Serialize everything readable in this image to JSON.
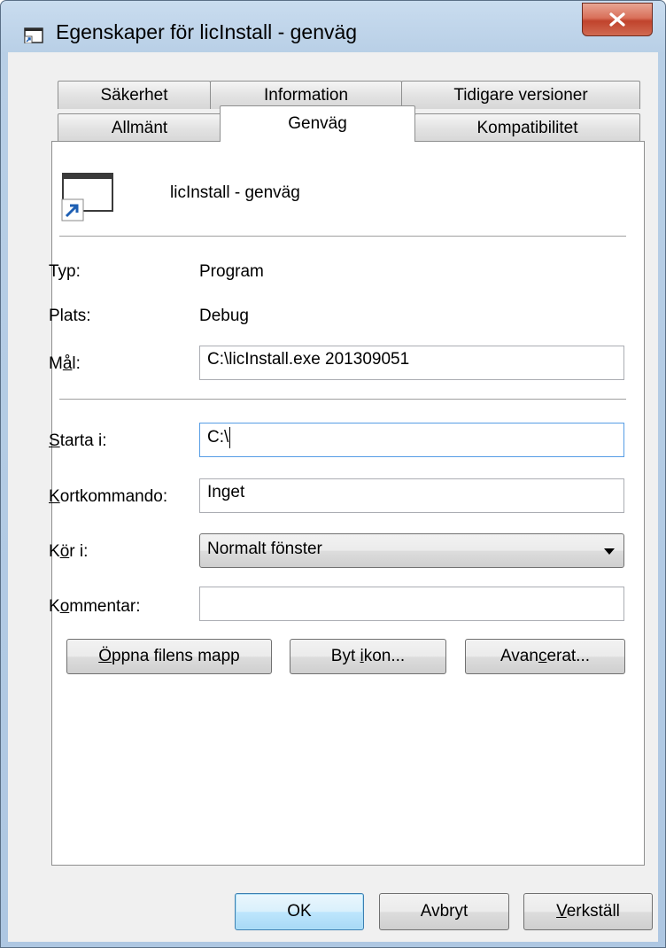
{
  "window": {
    "title": "Egenskaper för licInstall - genväg",
    "close_label": "X"
  },
  "tabs": {
    "row_back": [
      "Säkerhet",
      "Information",
      "Tidigare versioner"
    ],
    "row_front": [
      "Allmänt",
      "Genväg",
      "Kompatibilitet"
    ],
    "active": "Genväg"
  },
  "shortcut": {
    "name": "licInstall - genväg",
    "icon": "shortcut-window-icon"
  },
  "props": {
    "type_label": "Typ:",
    "type_value": "Program",
    "location_label": "Plats:",
    "location_value": "Debug",
    "target_label_pre": "M",
    "target_label_key": "å",
    "target_label_post": "l:",
    "target_value": "C:\\licInstall.exe 201309051",
    "startin_label_key": "S",
    "startin_label_post": "tarta i:",
    "startin_value": "C:\\",
    "hotkey_label_key": "K",
    "hotkey_label_post": "ortkommando:",
    "hotkey_value": "Inget",
    "run_label_pre": "K",
    "run_label_key": "ö",
    "run_label_post": "r i:",
    "run_value": "Normalt fönster",
    "comment_label_pre": "K",
    "comment_label_key": "o",
    "comment_label_post": "mmentar:",
    "comment_value": ""
  },
  "actions": {
    "open_pre": "",
    "open_key": "Ö",
    "open_post": "ppna filens mapp",
    "change_icon_pre": "Byt ",
    "change_icon_key": "i",
    "change_icon_post": "kon...",
    "advanced_pre": "Avan",
    "advanced_key": "c",
    "advanced_post": "erat..."
  },
  "footer": {
    "ok": "OK",
    "cancel": "Avbryt",
    "apply_key": "V",
    "apply_post": "erkställ"
  },
  "colors": {
    "frame": "#b8cfe6",
    "close": "#c0432c",
    "focus_border": "#569de5",
    "default_button": "#3c7fb1"
  }
}
